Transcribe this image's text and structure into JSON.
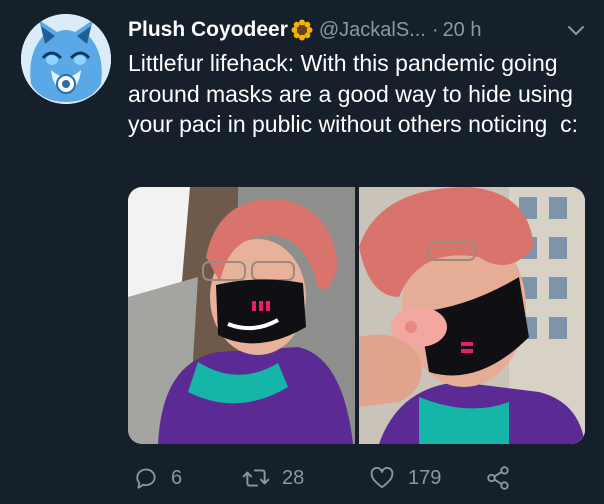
{
  "tweet": {
    "display_name": "Plush Coyodeer",
    "name_emoji": "sunflower-emoji",
    "handle": "@JackalS...",
    "separator": "·",
    "time": "20 h",
    "text": "Littlefur lifehack: With this pandemic going around masks are a good way to hide using your paci in public without others noticing  c:",
    "media": [
      {
        "name": "photo-selfie-mask-front"
      },
      {
        "name": "photo-selfie-mask-paci"
      }
    ],
    "actions": {
      "reply_count": "6",
      "retweet_count": "28",
      "like_count": "179"
    }
  },
  "colors": {
    "background": "#15202b",
    "text_primary": "#ffffff",
    "text_secondary": "#8899a6",
    "mask_accent": "#e91e63"
  },
  "icons": [
    "reply-icon",
    "retweet-icon",
    "like-icon",
    "share-icon",
    "chevron-down-icon"
  ]
}
